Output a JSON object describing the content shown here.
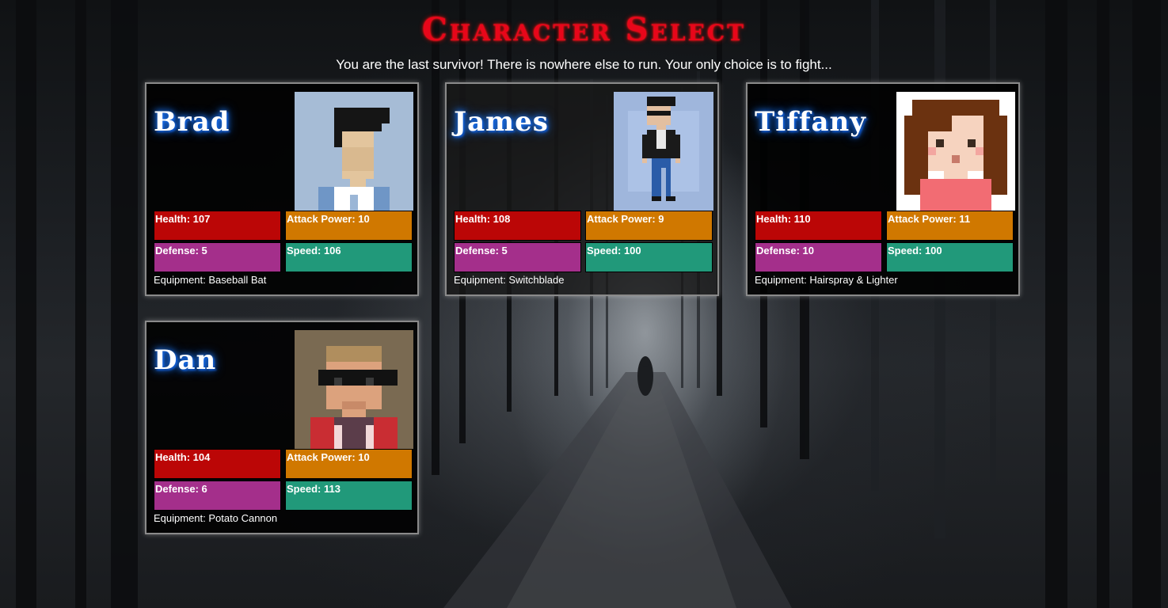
{
  "header": {
    "title": "Character Select",
    "subtitle": "You are the last survivor! There is nowhere else to run. Your only choice is to fight..."
  },
  "characters": [
    {
      "name": "Brad",
      "health": "Health: 107",
      "attack": "Attack Power: 10",
      "defense": "Defense: 5",
      "speed": "Speed: 106",
      "equipment": "Equipment: Baseball Bat",
      "portrait_icon": "brad-portrait-icon"
    },
    {
      "name": "James",
      "health": "Health: 108",
      "attack": "Attack Power: 9",
      "defense": "Defense: 5",
      "speed": "Speed: 100",
      "equipment": "Equipment: Switchblade",
      "portrait_icon": "james-portrait-icon"
    },
    {
      "name": "Tiffany",
      "health": "Health: 110",
      "attack": "Attack Power: 11",
      "defense": "Defense: 10",
      "speed": "Speed: 100",
      "equipment": "Equipment: Hairspray & Lighter",
      "portrait_icon": "tiffany-portrait-icon"
    },
    {
      "name": "Dan",
      "health": "Health: 104",
      "attack": "Attack Power: 10",
      "defense": "Defense: 6",
      "speed": "Speed: 113",
      "equipment": "Equipment: Potato Cannon",
      "portrait_icon": "dan-portrait-icon"
    }
  ],
  "colors": {
    "title": "#e8061a",
    "name_glow": "#1e7bff",
    "health": "#bb0606",
    "attack": "#d07800",
    "defense": "#a42f8b",
    "speed": "#21997a"
  }
}
